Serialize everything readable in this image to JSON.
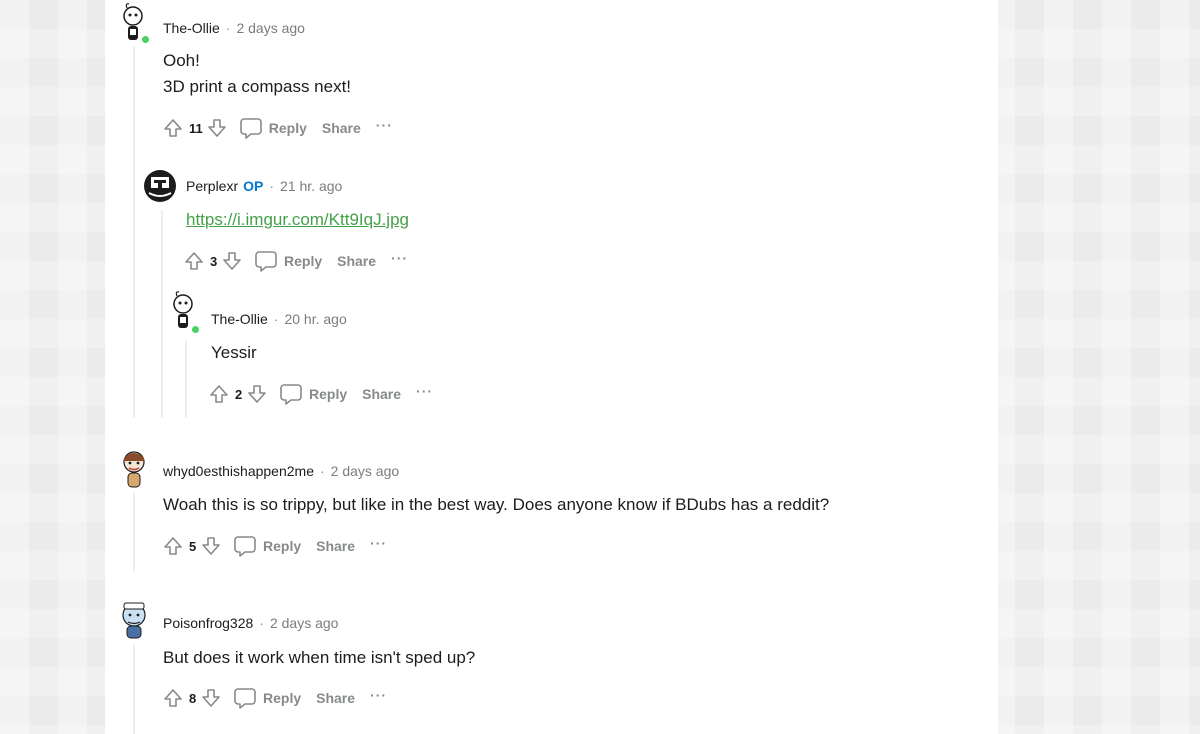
{
  "comments": [
    {
      "author": "The-Ollie",
      "op": "",
      "time": "2 days ago",
      "lines": [
        "Ooh!",
        "3D print a compass next!"
      ],
      "score": "11",
      "reply": "Reply",
      "share": "Share",
      "more": "···"
    },
    {
      "author": "Perplexr",
      "op": "OP",
      "time": "21 hr. ago",
      "link": "https://i.imgur.com/Ktt9IqJ.jpg",
      "score": "3",
      "reply": "Reply",
      "share": "Share",
      "more": "···"
    },
    {
      "author": "The-Ollie",
      "op": "",
      "time": "20 hr. ago",
      "lines": [
        "Yessir"
      ],
      "score": "2",
      "reply": "Reply",
      "share": "Share",
      "more": "···"
    },
    {
      "author": "whyd0esthishappen2me",
      "op": "",
      "time": "2 days ago",
      "lines": [
        "Woah this is so trippy, but like in the best way. Does anyone know if BDubs has a reddit?"
      ],
      "score": "5",
      "reply": "Reply",
      "share": "Share",
      "more": "···"
    },
    {
      "author": "Poisonfrog328",
      "op": "",
      "time": "2 days ago",
      "lines": [
        "But does it work when time isn't sped up?"
      ],
      "score": "8",
      "reply": "Reply",
      "share": "Share",
      "more": "···"
    }
  ],
  "separator": "·",
  "colors": {
    "online": "#46d160",
    "op": "#0079d3",
    "link": "#46a049",
    "muted": "#878a8c"
  },
  "icons": [
    "upvote-icon",
    "downvote-icon",
    "comment-bubble-icon",
    "more-options-icon"
  ]
}
